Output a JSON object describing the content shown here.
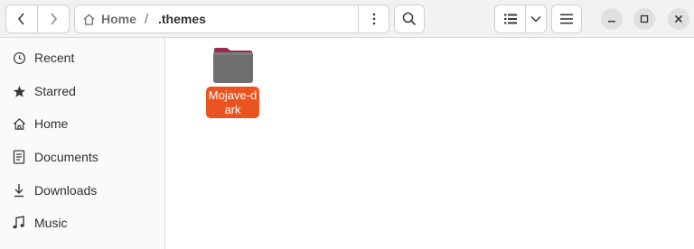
{
  "pathbar": {
    "home_label": "Home",
    "separator": "/",
    "current_label": ".themes"
  },
  "sidebar": {
    "items": [
      {
        "label": "Recent",
        "icon": "clock-icon"
      },
      {
        "label": "Starred",
        "icon": "star-icon"
      },
      {
        "label": "Home",
        "icon": "home-icon"
      },
      {
        "label": "Documents",
        "icon": "document-icon"
      },
      {
        "label": "Downloads",
        "icon": "download-icon"
      },
      {
        "label": "Music",
        "icon": "music-icon"
      }
    ]
  },
  "content": {
    "items": [
      {
        "name": "Mojave-dark",
        "type": "folder",
        "selected": true
      }
    ]
  },
  "colors": {
    "accent": "#e95420",
    "folder": "#6f6f6f",
    "folder_tab": "#9a2c54"
  }
}
